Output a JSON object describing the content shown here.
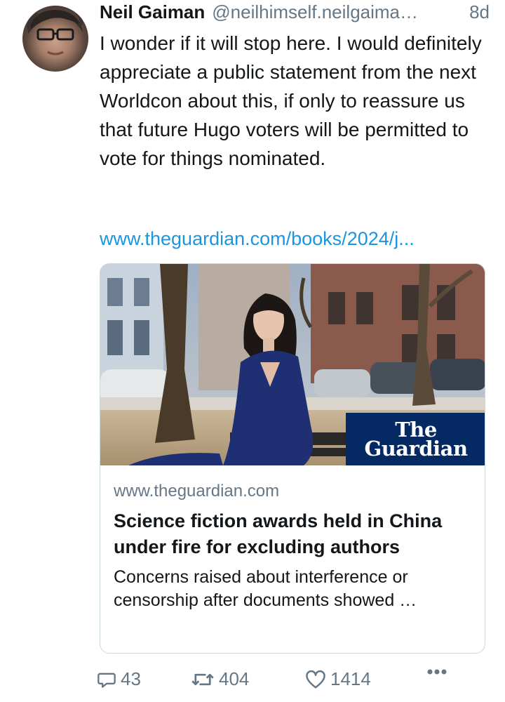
{
  "author": {
    "name": "Neil Gaiman",
    "handle": "@neilhimself.neilgaima…",
    "time": "8d"
  },
  "tweet": {
    "text": "I wonder if it will stop here. I would definitely appreciate a public statement from the next Worldcon about this, if only to reassure us that future Hugo voters will be permitted to vote for things nominated.",
    "link": "www.theguardian.com/books/2024/j..."
  },
  "card": {
    "logo_line1": "The",
    "logo_line2": "Guardian",
    "domain": "www.theguardian.com",
    "title": "Science fiction awards held in China under fire for excluding authors",
    "description": "Concerns raised about interference or censorship after documents showed …"
  },
  "actions": {
    "replies": "43",
    "reposts": "404",
    "likes": "1414"
  },
  "colors": {
    "link": "#1b95e0",
    "secondary_text": "#657786",
    "guardian_blue": "#052962",
    "card_border": "#ccd6dd"
  },
  "icons": [
    "reply-icon",
    "repost-icon",
    "like-icon",
    "more-icon"
  ]
}
